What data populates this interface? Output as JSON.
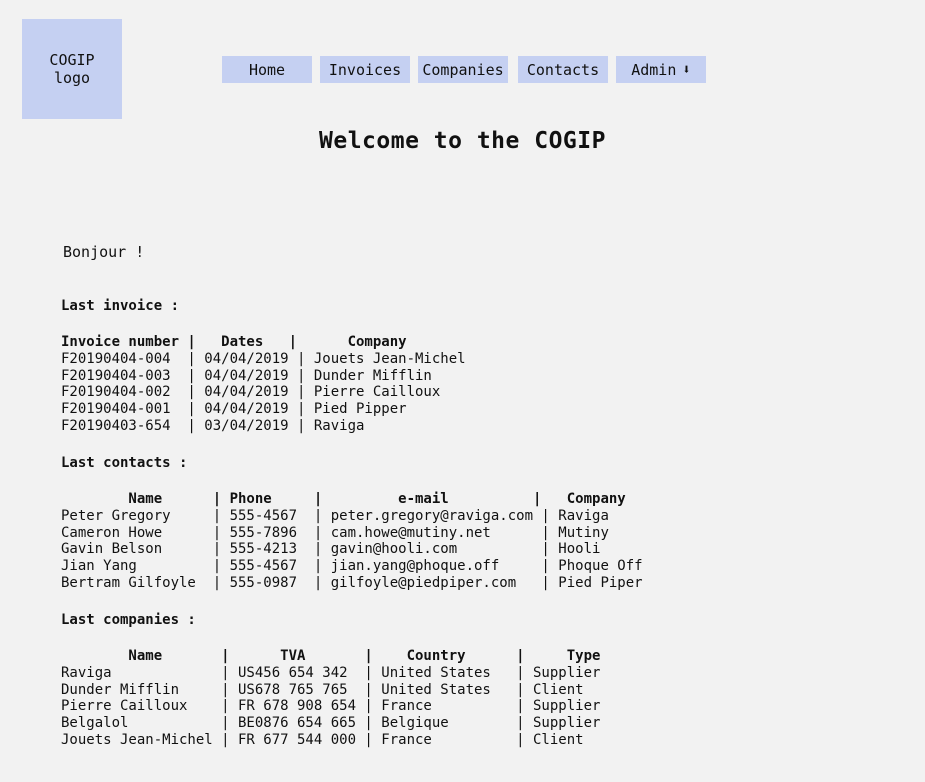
{
  "logo": {
    "line1": "COGIP",
    "line2": "logo"
  },
  "nav": {
    "home": "Home",
    "invoices": "Invoices",
    "companies": "Companies",
    "contacts": "Contacts",
    "admin": "Admin",
    "admin_icon": "arrow-down-icon"
  },
  "page_title": "Welcome to the COGIP",
  "greeting": "Bonjour !",
  "invoices": {
    "title": "Last invoice :",
    "header": "Invoice number |   Dates   |      Company",
    "rows": [
      "F20190404-004  | 04/04/2019 | Jouets Jean-Michel",
      "F20190404-003  | 04/04/2019 | Dunder Mifflin",
      "F20190404-002  | 04/04/2019 | Pierre Cailloux",
      "F20190404-001  | 04/04/2019 | Pied Pipper",
      "F20190403-654  | 03/04/2019 | Raviga"
    ]
  },
  "contacts": {
    "title": "Last contacts :",
    "header": "        Name      | Phone     |         e-mail          |   Company",
    "rows": [
      "Peter Gregory     | 555-4567  | peter.gregory@raviga.com | Raviga",
      "Cameron Howe      | 555-7896  | cam.howe@mutiny.net      | Mutiny",
      "Gavin Belson      | 555-4213  | gavin@hooli.com          | Hooli",
      "Jian Yang         | 555-4567  | jian.yang@phoque.off     | Phoque Off",
      "Bertram Gilfoyle  | 555-0987  | gilfoyle@piedpiper.com   | Pied Piper"
    ]
  },
  "companies": {
    "title": "Last companies :",
    "header": "        Name       |      TVA       |    Country      |     Type",
    "rows": [
      "Raviga             | US456 654 342  | United States   | Supplier",
      "Dunder Mifflin     | US678 765 765  | United States   | Client",
      "Pierre Cailloux    | FR 678 908 654 | France          | Supplier",
      "Belgalol           | BE0876 654 665 | Belgique        | Supplier",
      "Jouets Jean-Michel | FR 677 544 000 | France          | Client"
    ]
  }
}
